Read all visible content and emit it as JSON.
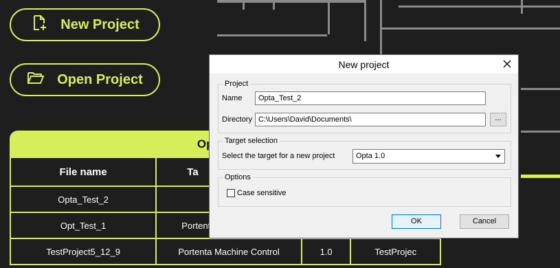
{
  "buttons": {
    "new_project": "New Project",
    "open_project": "Open Project"
  },
  "recent": {
    "header": "Open an e",
    "columns": [
      "File name",
      "Ta",
      "",
      ""
    ],
    "rows": [
      [
        "Opta_Test_2",
        "",
        "",
        ""
      ],
      [
        "Opt_Test_1",
        "Portent",
        "",
        ""
      ],
      [
        "TestProject5_12_9",
        "Portenta Machine Control",
        "1.0",
        "TestProjec"
      ]
    ]
  },
  "dialog": {
    "title": "New project",
    "project_group": "Project",
    "name_label": "Name",
    "name_value": "Opta_Test_2",
    "directory_label": "Directory",
    "directory_value": "C:\\Users\\David\\Documents\\",
    "browse_label": "...",
    "target_group": "Target selection",
    "target_label": "Select the target for a new project",
    "target_value": "Opta 1.0",
    "options_group": "Options",
    "case_sensitive_label": "Case sensitive",
    "ok_label": "OK",
    "cancel_label": "Cancel"
  },
  "colors": {
    "accent": "#d6ee5a",
    "background": "#1e1e1e"
  },
  "icons": {
    "new_project": "new-file-icon",
    "open_project": "folder-open-icon",
    "close": "close-icon"
  }
}
